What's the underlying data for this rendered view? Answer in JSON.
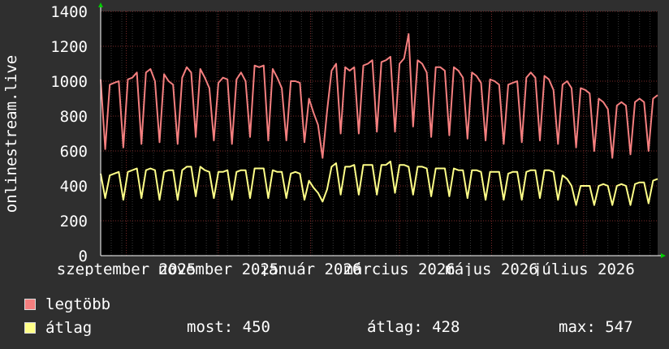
{
  "chart_data": {
    "type": "line",
    "ylabel": "onlinestream.live",
    "ylim": [
      0,
      1400
    ],
    "yticks": [
      0,
      200,
      400,
      600,
      800,
      1000,
      1200,
      1400
    ],
    "xlim": [
      "2025-08-15",
      "2026-08-19"
    ],
    "xticks": [
      {
        "label": "szeptember 2025",
        "date": "2025-09-01"
      },
      {
        "label": "november 2025",
        "date": "2025-11-01"
      },
      {
        "label": "január 2026",
        "date": "2026-01-01"
      },
      {
        "label": "március 2026",
        "date": "2026-03-01"
      },
      {
        "label": "május 2026",
        "date": "2026-05-01"
      },
      {
        "label": "július 2026",
        "date": "2026-07-01"
      }
    ],
    "grid": true,
    "series": [
      {
        "name": "legtöbb",
        "color": "#f47f7f",
        "x_start": "2025-08-15",
        "x_step_days": 3,
        "values": [
          1010,
          610,
          980,
          990,
          1000,
          620,
          1010,
          1020,
          1050,
          640,
          1050,
          1070,
          1000,
          650,
          1040,
          1000,
          980,
          640,
          1020,
          1080,
          1050,
          680,
          1070,
          1020,
          960,
          660,
          990,
          1020,
          1010,
          640,
          1010,
          1050,
          1000,
          680,
          1090,
          1080,
          1090,
          660,
          1070,
          1020,
          960,
          660,
          1000,
          1000,
          990,
          650,
          900,
          820,
          750,
          560,
          830,
          1060,
          1100,
          700,
          1080,
          1060,
          1080,
          700,
          1090,
          1100,
          1120,
          710,
          1110,
          1120,
          1140,
          710,
          1100,
          1130,
          1270,
          740,
          1120,
          1100,
          1050,
          680,
          1080,
          1080,
          1060,
          690,
          1080,
          1060,
          1020,
          670,
          1050,
          1030,
          990,
          660,
          1010,
          1000,
          980,
          640,
          980,
          990,
          1000,
          650,
          1020,
          1050,
          1020,
          660,
          1030,
          1010,
          950,
          640,
          980,
          1000,
          960,
          620,
          960,
          950,
          930,
          600,
          900,
          880,
          840,
          560,
          860,
          880,
          860,
          580,
          880,
          900,
          880,
          600,
          900,
          920,
          910,
          620,
          920,
          940,
          940,
          640
        ]
      },
      {
        "name": "átlag",
        "color": "#ffff88",
        "x_start": "2025-08-15",
        "x_step_days": 3,
        "values": [
          470,
          330,
          460,
          470,
          480,
          320,
          480,
          490,
          500,
          330,
          490,
          500,
          490,
          320,
          480,
          490,
          490,
          320,
          490,
          510,
          510,
          340,
          510,
          490,
          480,
          330,
          480,
          480,
          490,
          320,
          480,
          490,
          490,
          330,
          500,
          500,
          500,
          330,
          490,
          480,
          480,
          330,
          470,
          480,
          470,
          320,
          430,
          390,
          360,
          310,
          380,
          510,
          530,
          350,
          510,
          510,
          520,
          350,
          520,
          520,
          520,
          350,
          520,
          520,
          540,
          360,
          520,
          520,
          510,
          350,
          510,
          510,
          500,
          340,
          500,
          500,
          500,
          340,
          500,
          490,
          490,
          330,
          490,
          490,
          480,
          320,
          480,
          480,
          480,
          320,
          470,
          480,
          480,
          320,
          480,
          490,
          490,
          330,
          490,
          490,
          480,
          320,
          460,
          440,
          400,
          290,
          400,
          400,
          400,
          290,
          400,
          410,
          400,
          290,
          400,
          410,
          400,
          290,
          410,
          420,
          420,
          300,
          430,
          440,
          450,
          310
        ]
      }
    ]
  },
  "legend": {
    "max_label": "legtöbb",
    "avg_label": "átlag",
    "now": "most: 450",
    "avg": "átlag: 428",
    "max": "max: 547"
  }
}
